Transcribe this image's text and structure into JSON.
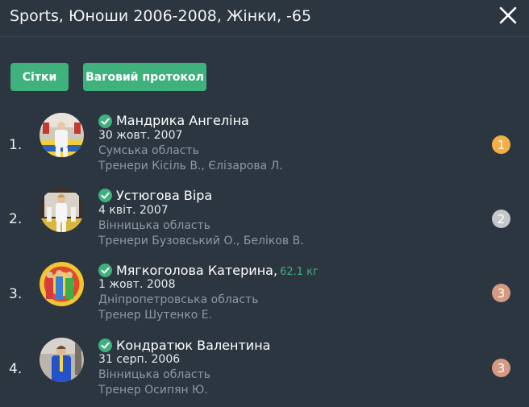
{
  "header": {
    "title": "Sports, Юноши 2006-2008, Жінки, -65",
    "close_icon": "close-icon"
  },
  "toolbar": {
    "grids_label": "Сітки",
    "weigh_in_label": "Ваговий протокол"
  },
  "colors": {
    "background": "#2b3640",
    "accent": "#3fb17d",
    "gold": "#f2b045",
    "silver": "#c5c7c9",
    "bronze": "#d59a82"
  },
  "athletes": [
    {
      "rank": "1.",
      "name": "Мандрика Ангеліна",
      "weight": "",
      "dob": "30 жовт. 2007",
      "region": "Сумська область",
      "coaches": "Тренери Кісіль В.,  Єлізарова Л.",
      "place": "1",
      "verified_icon": "check-circle-icon"
    },
    {
      "rank": "2.",
      "name": "Устюгова Віра",
      "weight": "",
      "dob": "4 квіт. 2007",
      "region": "Вінницька область",
      "coaches": "Тренери Бузовський О.,  Беліков В.",
      "place": "2",
      "verified_icon": "check-circle-icon"
    },
    {
      "rank": "3.",
      "name": "Мягкоголова Катерина,",
      "weight": "62.1 кг",
      "dob": "1 жовт. 2008",
      "region": "Дніпропетровська область",
      "coaches": "Тренер Шутенко Е.",
      "place": "3",
      "verified_icon": "check-circle-icon"
    },
    {
      "rank": "4.",
      "name": "Кондратюк Валентина",
      "weight": "",
      "dob": "31 серп. 2006",
      "region": "Вінницька область",
      "coaches": "Тренер Осипян Ю.",
      "place": "3",
      "verified_icon": "check-circle-icon"
    }
  ]
}
